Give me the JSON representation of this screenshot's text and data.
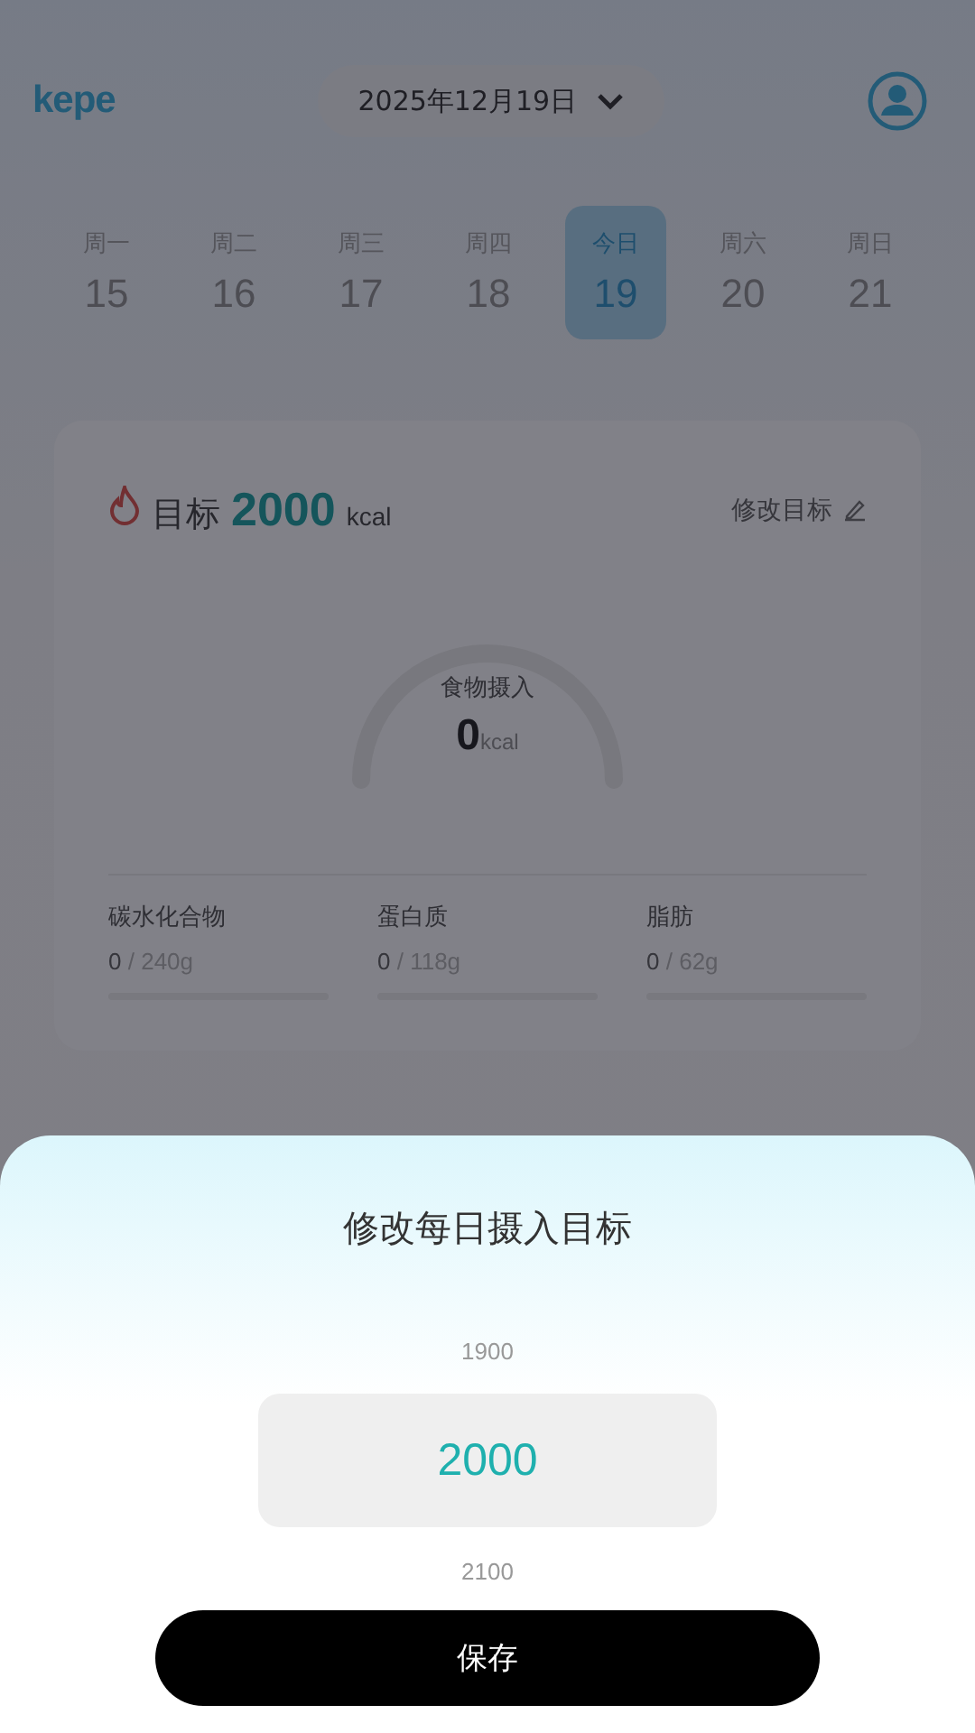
{
  "header": {
    "logo": "kepe",
    "date": "2025年12月19日"
  },
  "week": [
    {
      "day": "周一",
      "date": "15",
      "selected": false
    },
    {
      "day": "周二",
      "date": "16",
      "selected": false
    },
    {
      "day": "周三",
      "date": "17",
      "selected": false
    },
    {
      "day": "周四",
      "date": "18",
      "selected": false
    },
    {
      "day": "今日",
      "date": "19",
      "selected": true
    },
    {
      "day": "周六",
      "date": "20",
      "selected": false
    },
    {
      "day": "周日",
      "date": "21",
      "selected": false
    }
  ],
  "goal_card": {
    "label": "目标",
    "value": "2000",
    "unit": "kcal",
    "edit": "修改目标",
    "gauge": {
      "label": "食物摄入",
      "value": "0",
      "unit": "kcal"
    },
    "macros": [
      {
        "name": "碳水化合物",
        "value": "0",
        "total": "/ 240g",
        "level": 0
      },
      {
        "name": "蛋白质",
        "value": "0",
        "total": "/ 118g",
        "level": 0
      },
      {
        "name": "脂肪",
        "value": "0",
        "total": "/ 62g",
        "level": 0
      }
    ]
  },
  "sheet": {
    "title": "修改每日摄入目标",
    "options": [
      {
        "label": "1900",
        "selected": false
      },
      {
        "label": "2000",
        "selected": true
      },
      {
        "label": "2100",
        "selected": false
      }
    ],
    "button": "保存"
  }
}
